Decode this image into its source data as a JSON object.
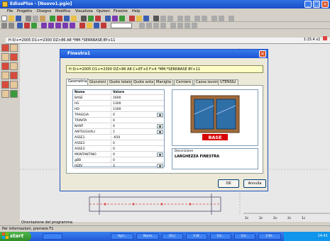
{
  "window": {
    "title": "EdiusPlus - [Nuovo1.pgio]",
    "controls": [
      "_",
      "□",
      "×"
    ]
  },
  "menu": [
    "File",
    "Progetto",
    "Disegno",
    "Modifica",
    "Visualizza",
    "Opzioni",
    "Finestre",
    "Help"
  ],
  "canvas": {
    "code_line": "H 0/+=2005 D1+=2300 DZ>86 A8 *MM.*SERRBASE:BY+11",
    "zoom": "1:15.4",
    "zoom_extra": "x1",
    "orientation_label": "Orientazione del programma",
    "ruler": [
      "2c",
      "2c",
      "2v",
      "2c",
      "1c"
    ]
  },
  "dialog": {
    "title": "Finestra1",
    "close": "×",
    "path": "H 0/+=2005 D1+=2300 DZ>86 A8 C+8T+0 F+4 *MM.*SERRBASE BY+11",
    "tabs": [
      "Geometria",
      "Giunzioni",
      "Quote telaio",
      "Quote anta",
      "Maniglia",
      "Cerniere",
      "Cassa lavoro",
      "UTENSILI"
    ],
    "active_tab": 0,
    "grid": {
      "headers": [
        "Nome",
        "Valore"
      ],
      "rows": [
        {
          "name": "BASE",
          "value": "1600",
          "dropdown": false
        },
        {
          "name": "HS",
          "value": "1300",
          "dropdown": false
        },
        {
          "name": "HD",
          "value": "1300",
          "dropdown": false
        },
        {
          "name": "TRAGGIA",
          "value": "0",
          "dropdown": true
        },
        {
          "name": "TRINITA",
          "value": "0",
          "dropdown": false
        },
        {
          "name": "NANT",
          "value": "4",
          "dropdown": true
        },
        {
          "name": "ANTEUGUALI",
          "value": "1",
          "dropdown": true
        },
        {
          "name": "ASSE1",
          "value": "-650",
          "dropdown": false
        },
        {
          "name": "ASSE2",
          "value": "0",
          "dropdown": false
        },
        {
          "name": "ASSE3",
          "value": "0",
          "dropdown": false
        },
        {
          "name": "MONTANTINO",
          "value": "0",
          "dropdown": true
        },
        {
          "name": "gBB",
          "value": "0",
          "dropdown": false
        },
        {
          "name": "HDIV",
          "value": "3",
          "dropdown": true
        }
      ]
    },
    "preview_label": "BASE",
    "description_label": "Descrizione",
    "description_value": "LARGHEZZA FINESTRA",
    "ok_button": "OK",
    "cancel_button": "Annulla",
    "colors": {
      "frame": "#a06a3a",
      "glass": "#2f6fa8",
      "label_bg": "#d90000"
    }
  },
  "statusbar": {
    "text": "Per informazioni, premere F1"
  },
  "taskbar": {
    "start": "start",
    "items": [
      "",
      "Apri...",
      "Norm...",
      "[EL]",
      "3 W...",
      "Ed...",
      "Ed...",
      "3 Nl...",
      "Not..."
    ],
    "clock": "14:41"
  }
}
